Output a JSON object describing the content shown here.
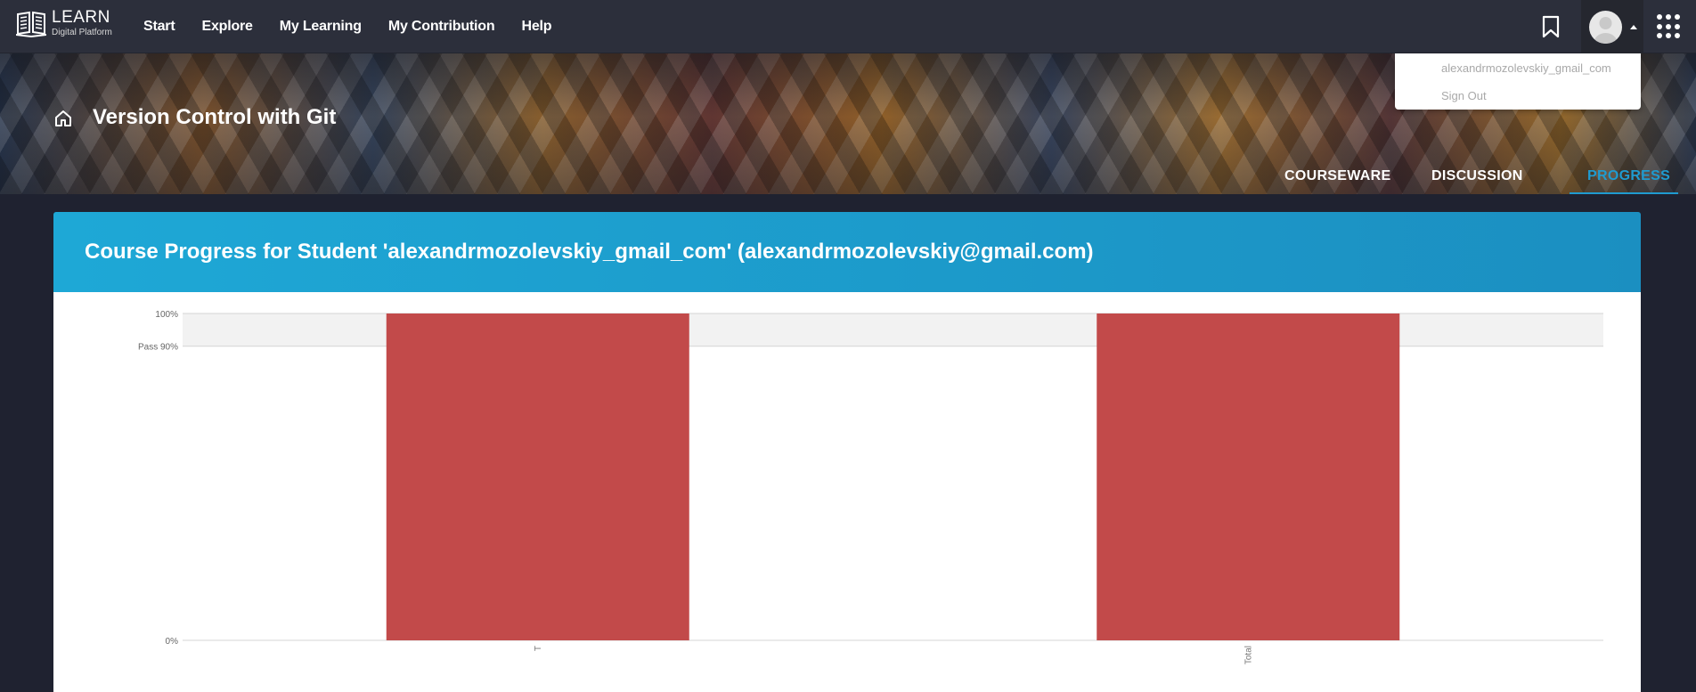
{
  "nav": {
    "logo_title": "LEARN",
    "logo_subtitle": "Digital Platform",
    "links": [
      "Start",
      "Explore",
      "My Learning",
      "My Contribution",
      "Help"
    ]
  },
  "user_menu": {
    "username": "alexandrmozolevskiy_gmail_com",
    "sign_out": "Sign Out"
  },
  "course": {
    "title": "Version Control with Git",
    "tabs": [
      "COURSEWARE",
      "DISCUSSION",
      "PROGRESS"
    ],
    "active_tab": "PROGRESS"
  },
  "progress": {
    "heading": "Course Progress for Student 'alexandrmozolevskiy_gmail_com' (alexandrmozolevskiy@gmail.com)"
  },
  "colors": {
    "accent": "#1f9bd0",
    "bar": "#c24a4a",
    "pass_band": "#f2f2f2"
  },
  "chart_data": {
    "type": "bar",
    "categories": [
      "T",
      "Total"
    ],
    "values": [
      100,
      100
    ],
    "ylim": [
      0,
      100
    ],
    "y_ticks": [
      {
        "value": 100,
        "label": "100%"
      },
      {
        "value": 90,
        "label": "Pass 90%"
      },
      {
        "value": 0,
        "label": "0%"
      }
    ],
    "pass_threshold": 90,
    "grid": false,
    "legend": "none",
    "title": "",
    "xlabel": "",
    "ylabel": ""
  }
}
